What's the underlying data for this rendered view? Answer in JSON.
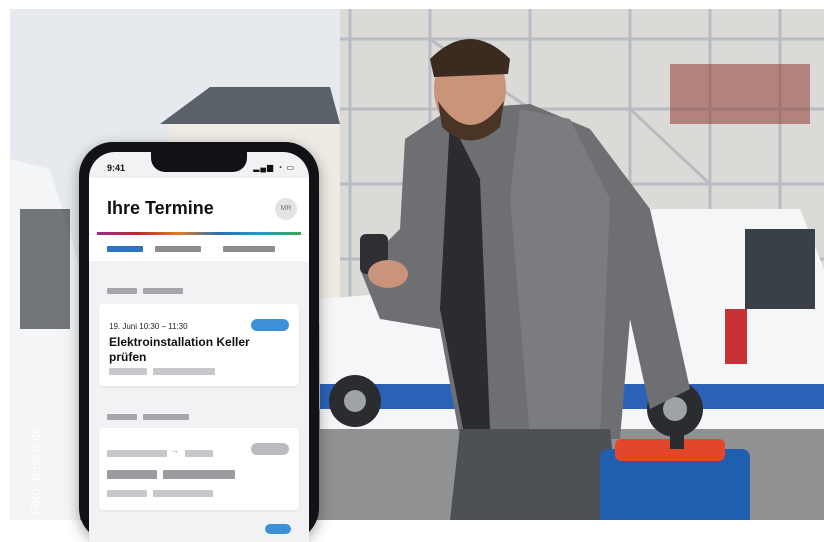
{
  "photo": {
    "credit": "Foto: bosch.de"
  },
  "phone": {
    "status_time": "9:41",
    "status_icons": "▂▄▆ ◔ ▭",
    "app_title": "Ihre Termine",
    "avatar_initials": "MR",
    "accent_color": "#2a74c3",
    "appointment": {
      "time": "19. Juni 10:30 – 11:30",
      "title": "Elektroinstallation Keller prüfen"
    },
    "arrow": "→"
  }
}
